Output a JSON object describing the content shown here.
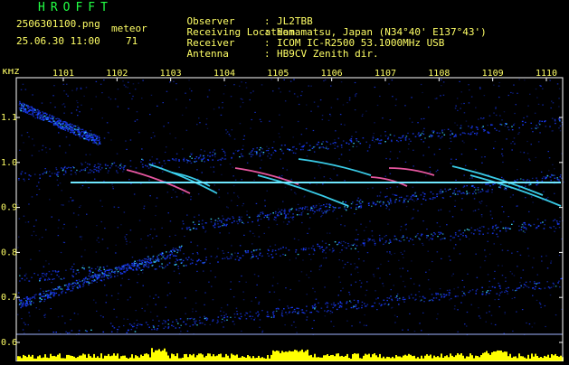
{
  "header": {
    "app_title": "HROFFT",
    "filename": "2506301100.png",
    "datetime": "25.06.30 11:00",
    "meteor_label": "meteor",
    "meteor_count": "71",
    "info": [
      {
        "label": "Observer",
        "value": "JL2TBB"
      },
      {
        "label": "Receiving Location",
        "value": "Hamamatsu, Japan (N34°40' E137°43')"
      },
      {
        "label": "Receiver",
        "value": "ICOM IC-R2500 53.1000MHz USB"
      },
      {
        "label": "Antenna",
        "value": "HB9CV Zenith dir."
      }
    ]
  },
  "plot": {
    "y_unit": "kHz",
    "y_ticks": [
      "1.1",
      "1.0",
      "0.9",
      "0.8",
      "0.7",
      "0.6"
    ],
    "x_ticks": [
      "1101",
      "1102",
      "1103",
      "1104",
      "1105",
      "1106",
      "1107",
      "1108",
      "1109",
      "1110"
    ],
    "colors": {
      "background": "#000000",
      "noise": "#1a3cff",
      "trace": "#3fe0ff",
      "hot": "#ff5fb0",
      "histogram": "#ffff00",
      "tick": "#ffffff",
      "label": "#ffff66"
    }
  }
}
